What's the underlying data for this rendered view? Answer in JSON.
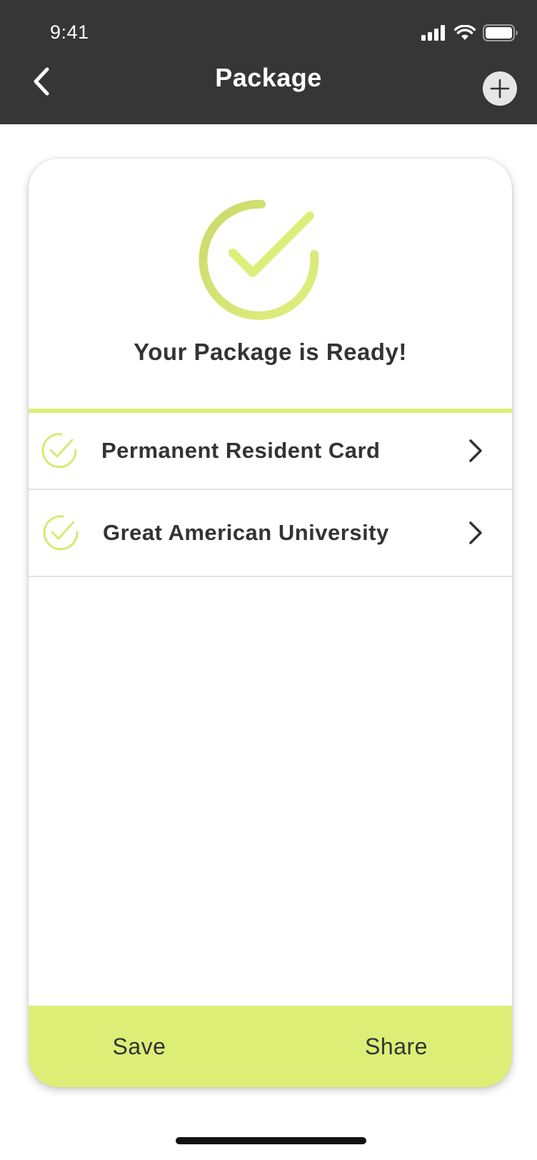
{
  "status_bar": {
    "time": "9:41",
    "icons": [
      "signal-icon",
      "wifi-icon",
      "battery-icon"
    ]
  },
  "nav": {
    "title": "Package",
    "back_icon": "chevron-left-icon",
    "add_icon": "plus-circle-icon"
  },
  "card": {
    "hero_icon": "check-circle-icon",
    "title": "Your Package is Ready!",
    "items": [
      {
        "label": "Permanent Resident Card",
        "status_icon": "check-circle-icon",
        "action_icon": "chevron-right-icon"
      },
      {
        "label": "Great American University",
        "status_icon": "check-circle-icon",
        "action_icon": "chevron-right-icon"
      }
    ],
    "actions": {
      "save_label": "Save",
      "share_label": "Share"
    }
  },
  "colors": {
    "header_bg": "#363636",
    "accent": "#dcee76",
    "text": "#333333"
  }
}
